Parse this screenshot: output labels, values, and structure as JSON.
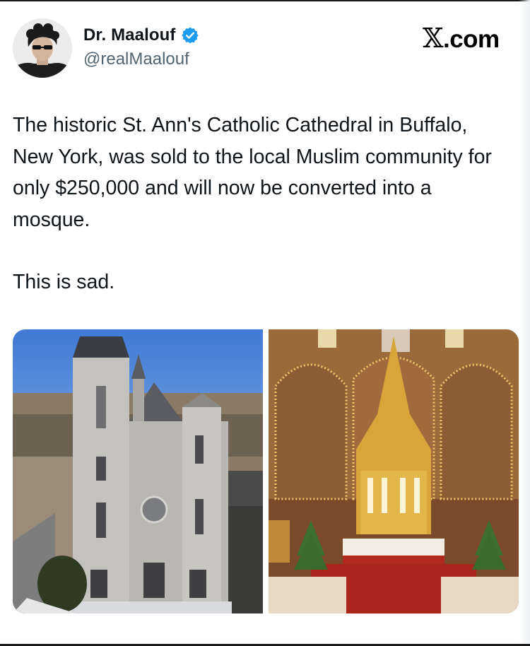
{
  "header": {
    "display_name": "Dr. Maalouf",
    "handle": "@realMaalouf",
    "verified_icon": "verified-badge-icon",
    "site_brand": ".com",
    "site_brand_glyph": "𝕏"
  },
  "tweet": {
    "paragraphs": [
      "The historic St. Ann's Catholic Cathedral in Buffalo, New York, was sold to the local Muslim community for only $250,000 and will now be converted into a mosque.",
      "This is sad."
    ]
  },
  "media": {
    "images": [
      {
        "subject": "church-exterior"
      },
      {
        "subject": "church-altar-interior"
      }
    ]
  },
  "colors": {
    "text_primary": "#0f1419",
    "text_secondary": "#536471",
    "verified_blue": "#1d9bf0"
  }
}
